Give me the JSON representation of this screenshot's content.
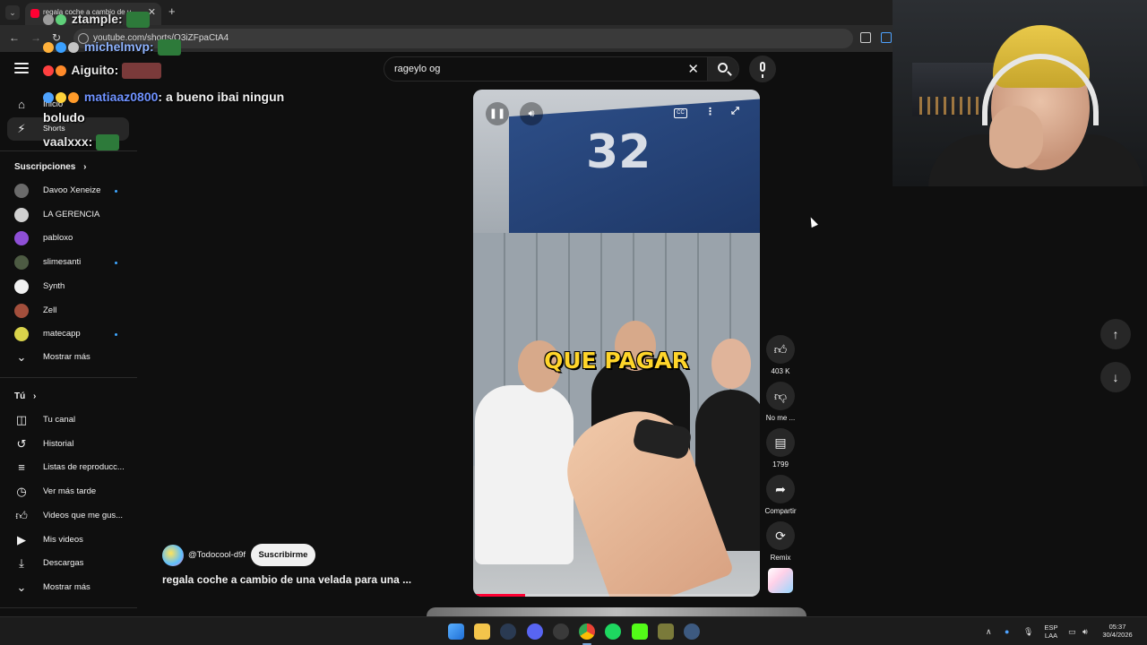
{
  "browser": {
    "tab_title": "regala coche a cambio de u",
    "url": "youtube.com/shorts/O3iZFpaCtA4"
  },
  "search": {
    "value": "rageylo og"
  },
  "sidebar": {
    "top": [
      {
        "label": "Inicio",
        "icon": "home-icon"
      },
      {
        "label": "Shorts",
        "icon": "shorts-icon"
      }
    ],
    "subscriptions_header": "Suscripciones",
    "subscriptions": [
      {
        "label": "Davoo Xeneize",
        "color": "#6b6b6b",
        "new": true
      },
      {
        "label": "LA GERENCIA",
        "color": "#d0d0d0",
        "new": false
      },
      {
        "label": "pabloxo",
        "color": "#8e4fd6",
        "new": false
      },
      {
        "label": "slimesanti",
        "color": "#4d5b43",
        "new": true
      },
      {
        "label": "Synth",
        "color": "#f1f1f1",
        "new": false
      },
      {
        "label": "Zell",
        "color": "#a34f3c",
        "new": false
      },
      {
        "label": "matecapp",
        "color": "#d9d34b",
        "new": true
      }
    ],
    "show_more": "Mostrar más",
    "you_header": "Tú",
    "you_items": [
      {
        "label": "Tu canal",
        "icon": "channel-icon"
      },
      {
        "label": "Historial",
        "icon": "history-icon"
      },
      {
        "label": "Listas de reproducc...",
        "icon": "playlists-icon"
      },
      {
        "label": "Ver más tarde",
        "icon": "watch-later-icon"
      },
      {
        "label": "Videos que me gus...",
        "icon": "liked-icon"
      },
      {
        "label": "Mis videos",
        "icon": "my-videos-icon"
      },
      {
        "label": "Descargas",
        "icon": "downloads-icon"
      }
    ],
    "show_more_2": "Mostrar más"
  },
  "chat": [
    {
      "user": "ztample:",
      "user_color": "#e8e8e8",
      "message": ""
    },
    {
      "user": "michelmvp:",
      "user_color": "#8fb4ff",
      "message": ""
    },
    {
      "user": "Aiguito:",
      "user_color": "#e8e8e8",
      "message": ""
    },
    {
      "user": "matiaaz0800",
      "user_color": "#6f92ff",
      "message": ": a bueno ibai ningun"
    },
    {
      "user": "",
      "user_color": "#e8e8e8",
      "message": "boludo"
    },
    {
      "user": "vaalxxx:",
      "user_color": "#e8e8e8",
      "message": ""
    }
  ],
  "video": {
    "caption": "QUE PAGAR",
    "banner_number": "32",
    "cc_label": "CC",
    "progress": 0.18
  },
  "actions": {
    "likes": "403 K",
    "dislike": "No me ...",
    "comments": "1799",
    "share": "Compartir",
    "remix": "Remix"
  },
  "short": {
    "channel": "@Todocool-d9f",
    "subscribe": "Suscribirme",
    "title": "regala coche a cambio de una velada para una ..."
  },
  "taskbar": {
    "lang_top": "ESP",
    "lang_bottom": "LAA",
    "time": "05:37",
    "date": "30/4/2026"
  }
}
